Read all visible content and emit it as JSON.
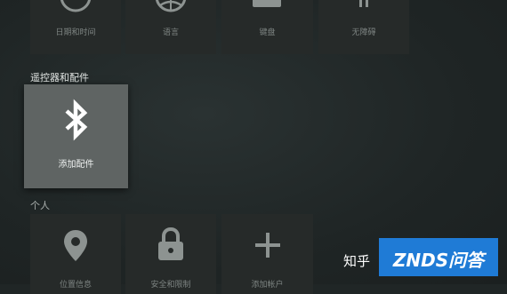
{
  "top_row": [
    {
      "label": "日期和时间",
      "icon": "clock-icon"
    },
    {
      "label": "语言",
      "icon": "globe-icon"
    },
    {
      "label": "键盘",
      "icon": "keyboard-icon"
    },
    {
      "label": "无障碍",
      "icon": "accessibility-icon"
    }
  ],
  "remote_section": {
    "title": "遥控器和配件",
    "add_accessory": {
      "label": "添加配件",
      "icon": "bluetooth-icon"
    }
  },
  "personal_section": {
    "title": "个人",
    "items": [
      {
        "label": "位置信息",
        "icon": "location-pin-icon"
      },
      {
        "label": "安全和限制",
        "icon": "lock-icon"
      },
      {
        "label": "添加帐户",
        "icon": "plus-icon"
      }
    ]
  },
  "watermark": {
    "zhihu": "知乎",
    "znds": "ZNDS问答"
  },
  "colors": {
    "background": "#202626",
    "tile": "#262a29",
    "focused_tile": "#5f6463",
    "watermark_blue": "#1f7bd6"
  }
}
